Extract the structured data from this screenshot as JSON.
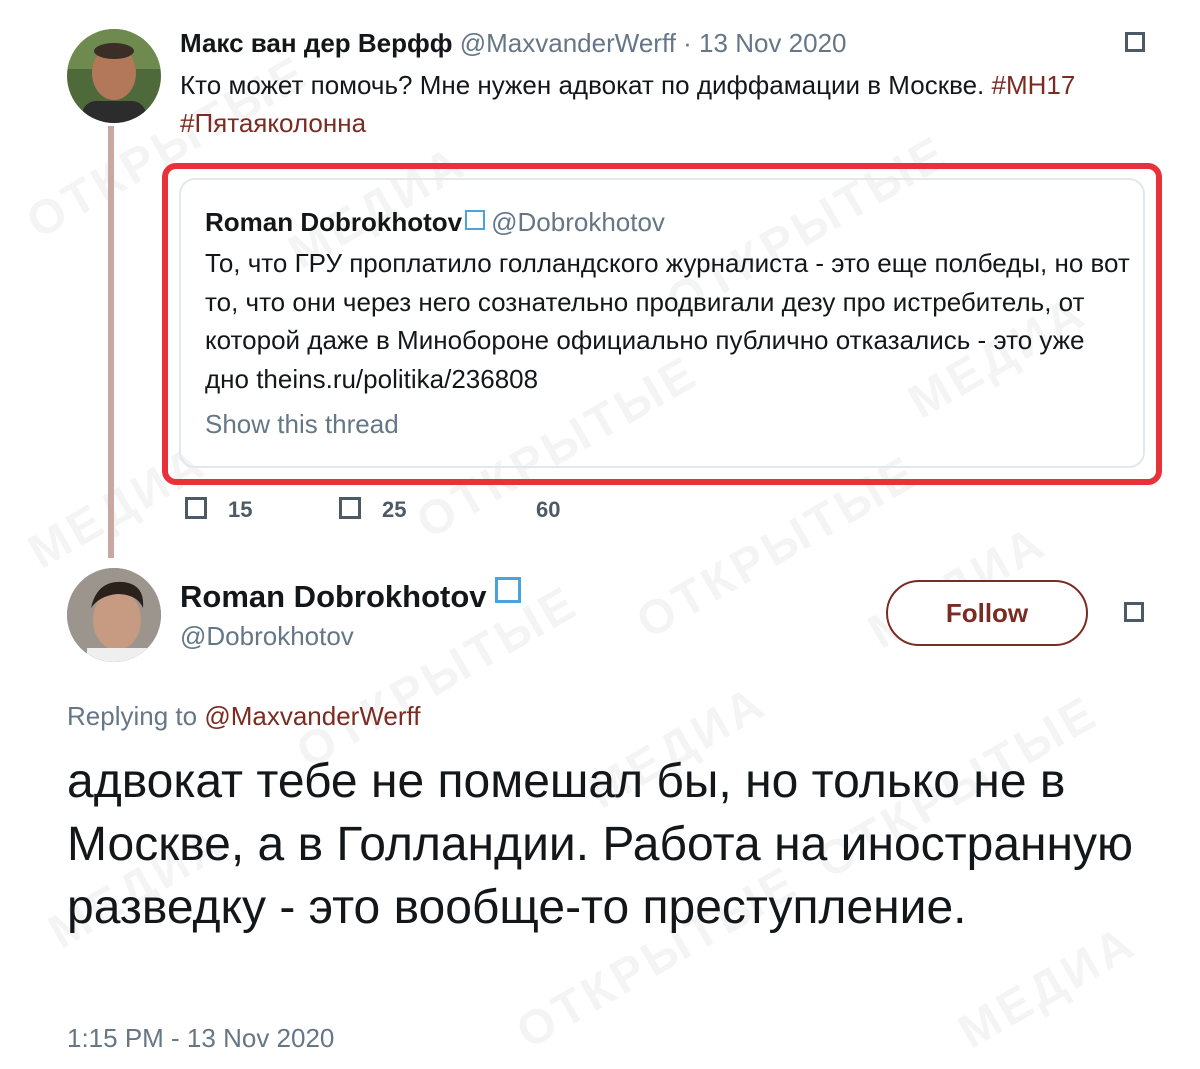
{
  "tweet1": {
    "author_name": "Макс ван дер Верфф",
    "handle": "@MaxvanderWerff",
    "separator": " · ",
    "date": "13 Nov 2020",
    "text": "Кто может помочь? Мне нужен адвокат по диффамации в Москве. ",
    "hashtag1": "#MH17",
    "hashtag2": "#Пятаяколонна",
    "quote": {
      "author_name": "Roman Dobrokhotov",
      "handle": "@Dobrokhotov",
      "text": "То, что ГРУ проплатило голландского журналиста - это еще полбеды, но вот то, что они через него сознательно продвигали дезу про истребитель, от которой даже в Минобороне официально публично отказались - это уже дно theins.ru/politika/236808",
      "show_thread": "Show this thread"
    },
    "actions": {
      "replies": "15",
      "retweets": "25",
      "likes": "60"
    }
  },
  "tweet2": {
    "author_name": "Roman Dobrokhotov",
    "handle": "@Dobrokhotov",
    "follow_label": "Follow",
    "replying_to_prefix": "Replying to ",
    "replying_to_handle": "@MaxvanderWerff",
    "text": "адвокат тебе не помешал бы, но только не в Москве, а в Голландии. Работа на иностранную разведку - это вообще-то преступление.",
    "timestamp": "1:15 PM - 13 Nov 2020"
  },
  "colors": {
    "link": "#7a2b22",
    "muted": "#657786",
    "highlight": "#e8323a",
    "verified": "#4aa3df"
  },
  "icons": {
    "verified": "verified-badge-icon",
    "caret": "caret-menu-icon",
    "reply": "reply-icon",
    "retweet": "retweet-icon"
  }
}
